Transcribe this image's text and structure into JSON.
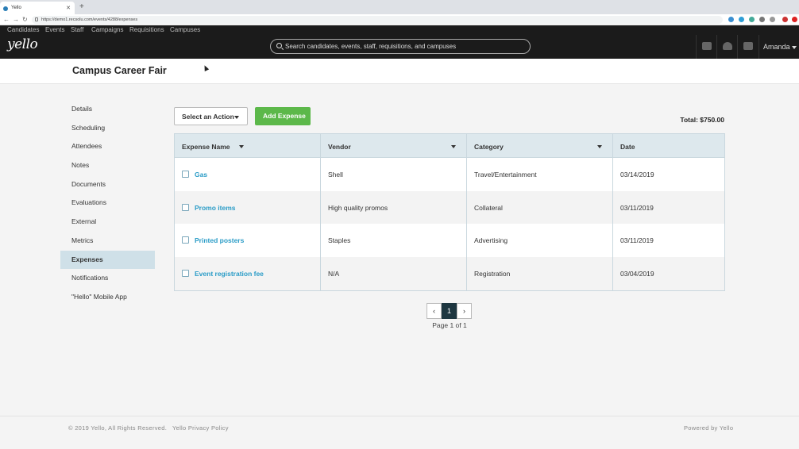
{
  "browser": {
    "tab_title": "Yello",
    "new_tab": "+",
    "url": "https://demo1.recsolu.com/events/4288/expenses"
  },
  "topnav": {
    "items": [
      "Candidates",
      "Events",
      "Staff",
      "Campaigns",
      "Requisitions",
      "Campuses"
    ]
  },
  "header": {
    "logo": "yello",
    "search_placeholder": "Search candidates, events, staff, requisitions, and campuses",
    "user": "Amanda"
  },
  "page": {
    "title": "Campus Career Fair"
  },
  "sidebar": {
    "items": [
      {
        "label": "Details"
      },
      {
        "label": "Scheduling"
      },
      {
        "label": "Attendees"
      },
      {
        "label": "Notes"
      },
      {
        "label": "Documents"
      },
      {
        "label": "Evaluations"
      },
      {
        "label": "External"
      },
      {
        "label": "Metrics"
      },
      {
        "label": "Expenses",
        "active": true
      },
      {
        "label": "Notifications"
      },
      {
        "label": "\"Hello\" Mobile App"
      }
    ]
  },
  "actions": {
    "select_action": "Select an Action",
    "add_expense": "Add Expense",
    "total": "Total: $750.00"
  },
  "table": {
    "headers": [
      "Expense Name",
      "Vendor",
      "Category",
      "Date"
    ],
    "rows": [
      {
        "name": "Gas",
        "vendor": "Shell",
        "category": "Travel/Entertainment",
        "date": "03/14/2019"
      },
      {
        "name": "Promo items",
        "vendor": "High quality promos",
        "category": "Collateral",
        "date": "03/11/2019"
      },
      {
        "name": "Printed posters",
        "vendor": "Staples",
        "category": "Advertising",
        "date": "03/11/2019"
      },
      {
        "name": "Event registration fee",
        "vendor": "N/A",
        "category": "Registration",
        "date": "03/04/2019"
      }
    ]
  },
  "pagination": {
    "current": "1",
    "label": "Page 1 of 1"
  },
  "footer": {
    "copyright": "© 2019 Yello, All Rights Reserved.",
    "privacy": "Yello Privacy Policy",
    "powered": "Powered by Yello"
  },
  "colors": {
    "accent": "#2a9cc7",
    "add_button": "#5cb84a",
    "active_nav": "#cfe0e8",
    "header_bg": "#1b1b1b"
  }
}
